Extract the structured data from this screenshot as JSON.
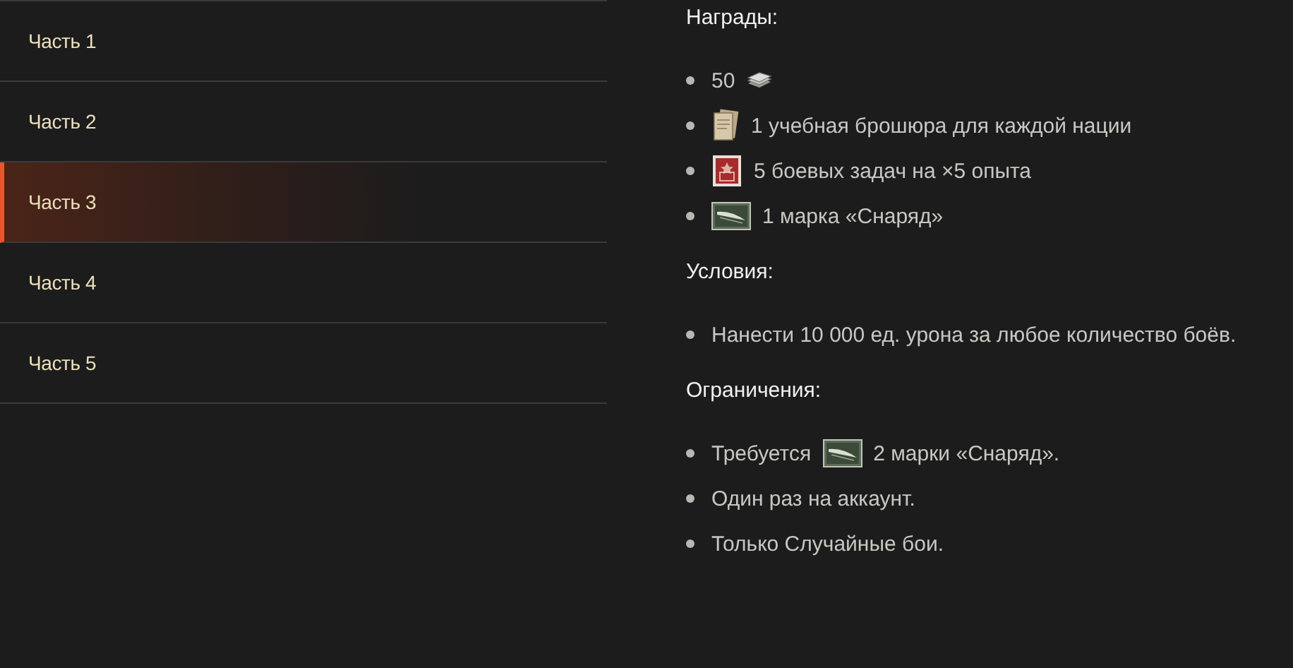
{
  "sidebar": {
    "items": [
      {
        "label": "Часть 1",
        "selected": false
      },
      {
        "label": "Часть 2",
        "selected": false
      },
      {
        "label": "Часть 3",
        "selected": true
      },
      {
        "label": "Часть 4",
        "selected": false
      },
      {
        "label": "Часть 5",
        "selected": false
      }
    ]
  },
  "sections": [
    {
      "heading": "Награды:",
      "items": [
        [
          {
            "kind": "text",
            "text": "50"
          },
          {
            "kind": "money"
          }
        ],
        [
          {
            "kind": "brochure"
          },
          {
            "kind": "text",
            "text": "1 учебная брошюра для каждой нации"
          }
        ],
        [
          {
            "kind": "mission"
          },
          {
            "kind": "text",
            "text": "5 боевых задач на ×5 опыта"
          }
        ],
        [
          {
            "kind": "stamp"
          },
          {
            "kind": "text",
            "text": "1 марка «Снаряд»"
          }
        ]
      ]
    },
    {
      "heading": "Условия:",
      "items": [
        [
          {
            "kind": "text",
            "text": "Нанести 10 000 ед. урона за любое количество боёв."
          }
        ]
      ]
    },
    {
      "heading": "Ограничения:",
      "items": [
        [
          {
            "kind": "text",
            "text": "Требуется"
          },
          {
            "kind": "stamp"
          },
          {
            "kind": "text",
            "text": "2 марки «Снаряд»."
          }
        ],
        [
          {
            "kind": "text",
            "text": "Один раз на аккаунт."
          }
        ],
        [
          {
            "kind": "text",
            "text": "Только Случайные бои."
          }
        ]
      ]
    }
  ]
}
